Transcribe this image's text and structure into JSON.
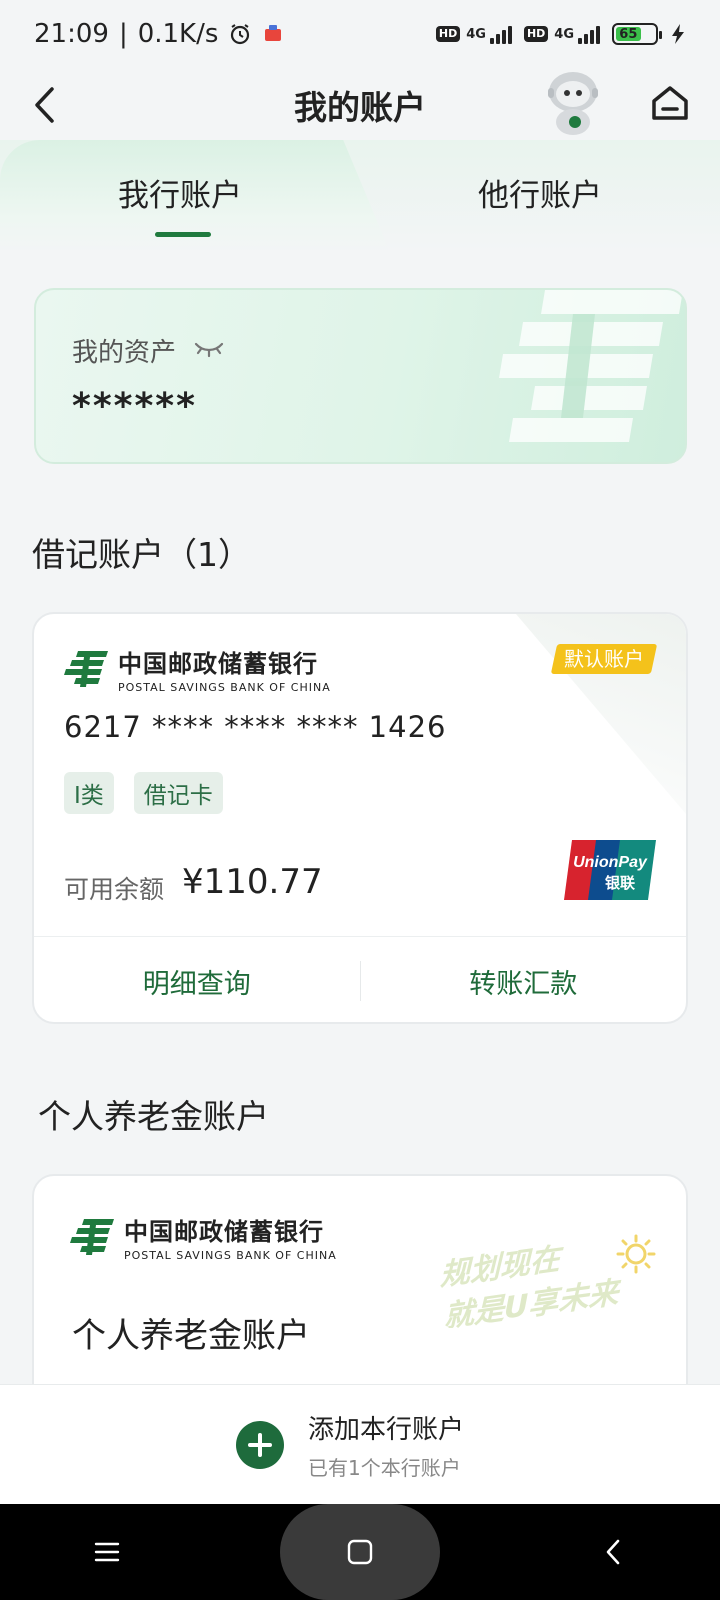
{
  "status_bar": {
    "time": "21:09",
    "separator": "|",
    "net_speed": "0.1K/s",
    "hd_label": "HD",
    "network_1": "4G",
    "network_2": "4G",
    "battery": "65",
    "icons": [
      "alarm-icon",
      "app-notification-icon",
      "signal-icon",
      "battery-icon",
      "charging-icon"
    ]
  },
  "header": {
    "title": "我的账户",
    "icons": [
      "back-icon",
      "mascot-icon",
      "home-icon"
    ]
  },
  "tabs": [
    {
      "label": "我行账户",
      "active": true
    },
    {
      "label": "他行账户",
      "active": false
    }
  ],
  "assets": {
    "label": "我的资产",
    "value": "******",
    "icon": "eye-closed-icon"
  },
  "debit_section": {
    "title": "借记账户（1）"
  },
  "debit_card": {
    "bank_name_cn": "中国邮政储蓄银行",
    "bank_name_en": "POSTAL SAVINGS BANK OF CHINA",
    "default_badge": "默认账户",
    "card_number": "6217 **** **** **** 1426",
    "tags": [
      "I类",
      "借记卡"
    ],
    "balance_label": "可用余额",
    "balance_value": "¥110.77",
    "unionpay_en": "UnionPay",
    "unionpay_cn": "银联",
    "actions": [
      "明细查询",
      "转账汇款"
    ]
  },
  "pension_section": {
    "title": "个人养老金账户"
  },
  "pension_card": {
    "bank_name_cn": "中国邮政储蓄银行",
    "bank_name_en": "POSTAL SAVINGS BANK OF CHINA",
    "slogan_line1": "规划现在",
    "slogan_line2": "就是U享未来",
    "title": "个人养老金账户"
  },
  "add_account": {
    "title": "添加本行账户",
    "subtitle": "已有1个本行账户"
  },
  "nav": {
    "icons": [
      "menu-icon",
      "home-square-icon",
      "nav-back-icon"
    ]
  },
  "colors": {
    "brand_green": "#1f7a3e",
    "badge_yellow": "#f4c21b",
    "tag_bg": "#e6efe9"
  }
}
